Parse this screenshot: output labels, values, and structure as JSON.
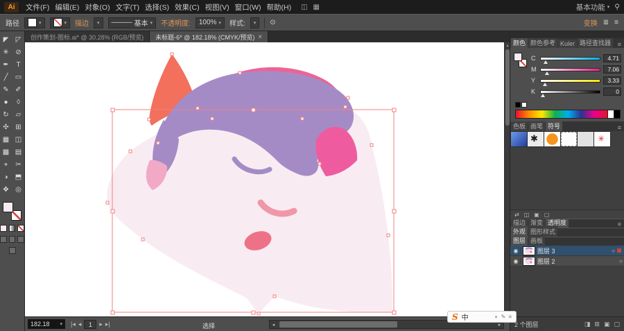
{
  "menubar": {
    "logo": "Ai",
    "menus": [
      "文件(F)",
      "编辑(E)",
      "对象(O)",
      "文字(T)",
      "选择(S)",
      "效果(C)",
      "视图(V)",
      "窗口(W)",
      "帮助(H)"
    ],
    "arrange_icon": "◫",
    "grid_icon": "▦",
    "workspace": "基本功能",
    "dropdown_icon": "▾",
    "search_icon": "⚲"
  },
  "controlbar": {
    "selection_type": "路径",
    "dropdown_icon": "▾",
    "stroke_link": "描边",
    "line_glyph": "———",
    "line_style": "基本",
    "opacity_label": "不透明度:",
    "opacity_value": "100%",
    "style_label": "样式:",
    "recolor_icon": "⊙",
    "transform_link": "变换",
    "align_icon": "≣",
    "menu_icon": "≡"
  },
  "tabs": [
    {
      "title": "创作策划-图标.ai* @ 30.28% (RGB/预览)"
    },
    {
      "title": "未标题-6* @ 182.18% (CMYK/预览)",
      "close": "×"
    }
  ],
  "tools": [
    {
      "name": "selection-tool",
      "glyph": "◤"
    },
    {
      "name": "direct-selection-tool",
      "glyph": "◸"
    },
    {
      "name": "magic-wand-tool",
      "glyph": "✳"
    },
    {
      "name": "lasso-tool",
      "glyph": "⊘"
    },
    {
      "name": "pen-tool",
      "glyph": "✒"
    },
    {
      "name": "type-tool",
      "glyph": "T"
    },
    {
      "name": "line-tool",
      "glyph": "╱"
    },
    {
      "name": "rectangle-tool",
      "glyph": "▭"
    },
    {
      "name": "pencil-tool",
      "glyph": "✎"
    },
    {
      "name": "paintbrush-tool",
      "glyph": "✐"
    },
    {
      "name": "blob-brush-tool",
      "glyph": "●"
    },
    {
      "name": "eraser-tool",
      "glyph": "◊"
    },
    {
      "name": "rotate-tool",
      "glyph": "↻"
    },
    {
      "name": "scale-tool",
      "glyph": "▱"
    },
    {
      "name": "width-tool",
      "glyph": "✣"
    },
    {
      "name": "free-transform-tool",
      "glyph": "⊞"
    },
    {
      "name": "shape-builder-tool",
      "glyph": "▦"
    },
    {
      "name": "perspective-grid-tool",
      "glyph": "◫"
    },
    {
      "name": "mesh-tool",
      "glyph": "▩"
    },
    {
      "name": "gradient-tool",
      "glyph": "▤"
    },
    {
      "name": "eyedropper-tool",
      "glyph": "⌖"
    },
    {
      "name": "scissors-tool",
      "glyph": "✂"
    },
    {
      "name": "blend-tool",
      "glyph": "◑"
    },
    {
      "name": "artboard-tool",
      "glyph": "⬒"
    },
    {
      "name": "hand-tool",
      "glyph": "✥"
    },
    {
      "name": "zoom-tool",
      "glyph": "◎"
    }
  ],
  "canvas": {
    "colors": {
      "head": "#f8ecf2",
      "horn": "#f2705c",
      "mane": "#a58bc6",
      "mane_pink": "#ec6494",
      "wisp_pink": "#f2a9c5",
      "inner_ear": "#ee5c9f",
      "eye": "#a58bc6",
      "mouth": "#f097a8",
      "nostril": "#ee7287",
      "selection": "#f08080"
    }
  },
  "color_panel": {
    "tabs": [
      "颜色",
      "颜色参考",
      "Kuler",
      "路径查找器"
    ],
    "menu_icon": "≡",
    "sliders": [
      {
        "channel": "C",
        "value": "4.71"
      },
      {
        "channel": "M",
        "value": "7.06"
      },
      {
        "channel": "Y",
        "value": "3.33"
      },
      {
        "channel": "K",
        "value": "0"
      }
    ]
  },
  "symbols_panel": {
    "tabs": [
      "色板",
      "画笔",
      "符号"
    ],
    "menu_icon": "≡",
    "footer_icons": [
      {
        "name": "symbol-libraries-icon",
        "glyph": "⇄"
      },
      {
        "name": "place-symbol-icon",
        "glyph": "◫"
      },
      {
        "name": "new-symbol-icon",
        "glyph": "▣"
      },
      {
        "name": "delete-symbol-icon",
        "glyph": "▢"
      }
    ]
  },
  "panels": {
    "stroke_tabs": [
      "描边",
      "渐变",
      "透明度"
    ],
    "appearance_tabs": [
      "外观",
      "图形样式"
    ],
    "layers_tabs": [
      "图层",
      "画板"
    ],
    "menu_icon": "≡"
  },
  "layers_panel": {
    "eye_icon": "◉",
    "target_icon": "○",
    "rows": [
      {
        "name": "图层 3"
      },
      {
        "name": "图层 2"
      }
    ],
    "status": "2 个图层",
    "footer_icons": [
      {
        "name": "make-mask-icon",
        "glyph": "◨"
      },
      {
        "name": "new-sublayer-icon",
        "glyph": "⊞"
      },
      {
        "name": "new-layer-icon",
        "glyph": "▣"
      },
      {
        "name": "delete-layer-icon",
        "glyph": "▢"
      }
    ]
  },
  "statusbar": {
    "zoom": "182.18",
    "dropdown_icon": "▾",
    "first_icon": "|◂",
    "prev_icon": "◂",
    "artboard": "1",
    "next_icon": "▸",
    "last_icon": "▸|",
    "status_text": "选择",
    "left_icon": "◂",
    "right_icon": "▸",
    "up_icon": "▴",
    "down_icon": "▾"
  },
  "ime": {
    "logo": "S",
    "text": "中",
    "icons": [
      "◐",
      "✎",
      "≡"
    ]
  }
}
